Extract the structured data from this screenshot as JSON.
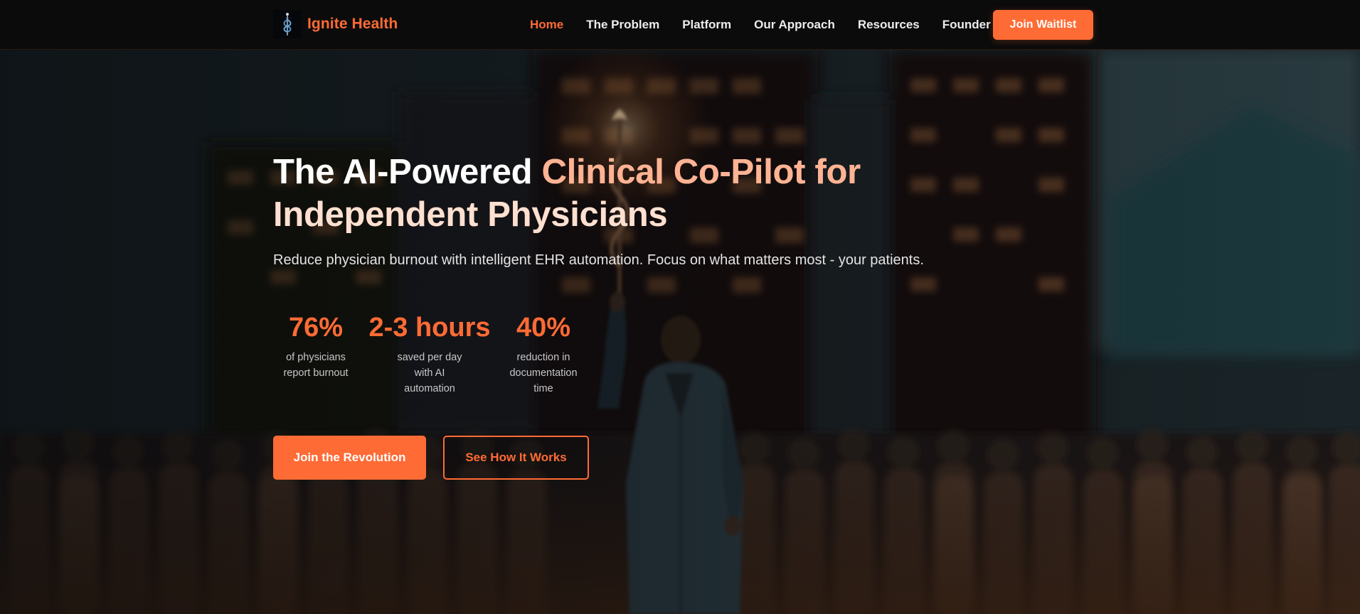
{
  "brand": {
    "name": "Ignite Health",
    "logo_icon": "caduceus-icon",
    "accent_color": "#ff6b35"
  },
  "nav": {
    "items": [
      {
        "label": "Home",
        "active": true
      },
      {
        "label": "The Problem",
        "active": false
      },
      {
        "label": "Platform",
        "active": false
      },
      {
        "label": "Our Approach",
        "active": false
      },
      {
        "label": "Resources",
        "active": false
      },
      {
        "label": "Founder",
        "active": false
      }
    ],
    "cta_label": "Join Waitlist"
  },
  "hero": {
    "headline_part1": "The AI-Powered ",
    "headline_part2": "Clinical Co-Pilot for",
    "headline_part3": "Independent Physicians",
    "subtitle": "Reduce physician burnout with intelligent EHR automation. Focus on what matters most - your patients.",
    "stats": [
      {
        "value": "76%",
        "label": "of physicians report burnout"
      },
      {
        "value": "2-3 hours",
        "label": "saved per day with AI automation"
      },
      {
        "value": "40%",
        "label": "reduction in documentation time"
      }
    ],
    "primary_cta": "Join the Revolution",
    "secondary_cta": "See How It Works"
  }
}
